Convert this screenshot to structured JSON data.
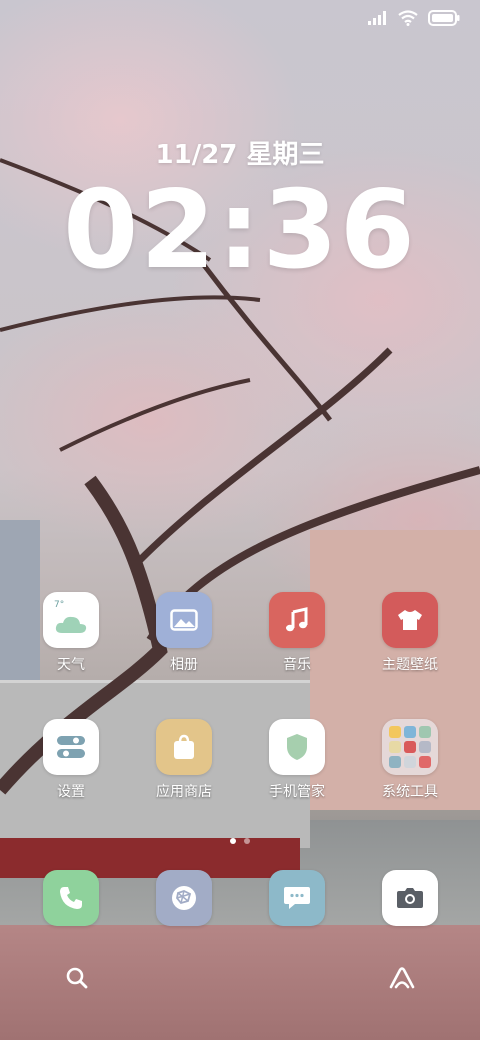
{
  "status_bar": {
    "icons": [
      "signal-icon",
      "wifi-icon",
      "battery-icon"
    ]
  },
  "lockscreen": {
    "date": "11/27 星期三",
    "time": "02:36"
  },
  "home": {
    "row1": [
      {
        "label": "天气",
        "icon": "weather-icon"
      },
      {
        "label": "相册",
        "icon": "gallery-icon"
      },
      {
        "label": "音乐",
        "icon": "music-icon"
      },
      {
        "label": "主题壁纸",
        "icon": "theme-icon"
      }
    ],
    "row2": [
      {
        "label": "设置",
        "icon": "settings-icon"
      },
      {
        "label": "应用商店",
        "icon": "app-store-icon"
      },
      {
        "label": "手机管家",
        "icon": "security-icon"
      },
      {
        "label": "系统工具",
        "icon": "folder-icon"
      }
    ],
    "weather_temp": "7°"
  },
  "pager": {
    "pages": 2,
    "current": 1
  },
  "dock": [
    "phone-icon",
    "browser-icon",
    "messages-icon",
    "camera-icon"
  ],
  "bottom": {
    "left": "search-icon",
    "right": "assistant-icon"
  },
  "colors": {
    "weather": "#ffffff",
    "gallery": "#9fb0d7",
    "music": "#d9655f",
    "theme": "#d35b5b",
    "settings": "#ffffff",
    "app_store": "#e3c58a",
    "security": "#ffffff",
    "phone": "#8fd29c",
    "browser": "#a2acc6",
    "messages": "#8db9c9",
    "camera": "#ffffff"
  }
}
